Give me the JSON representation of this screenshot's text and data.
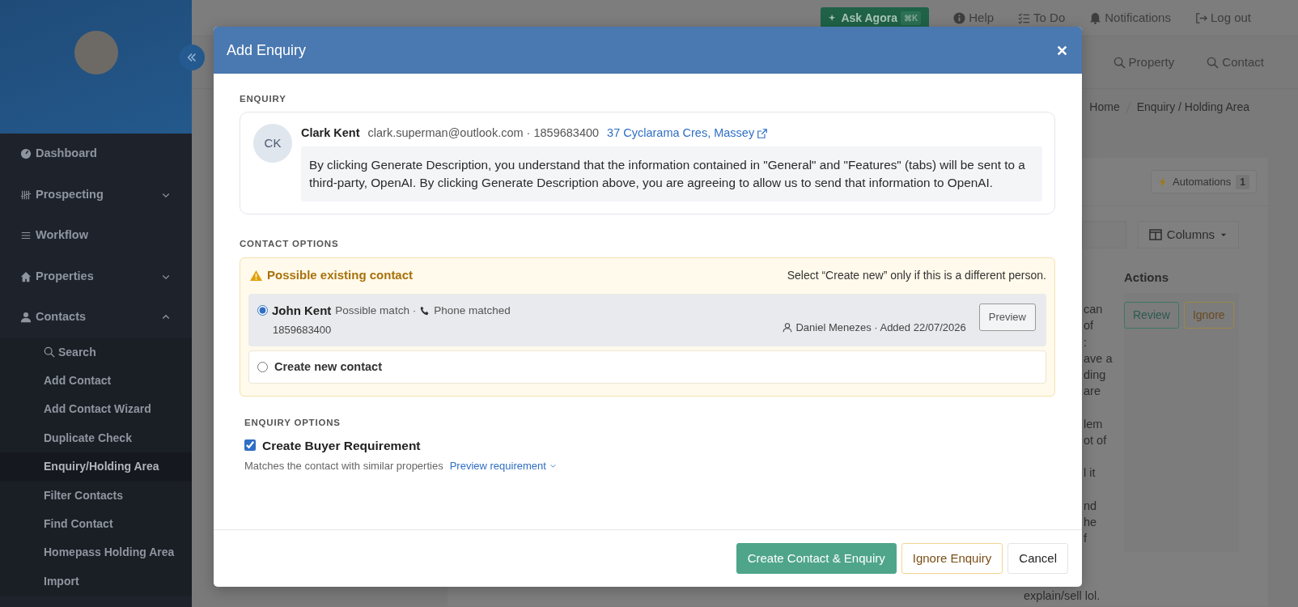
{
  "sidebar": {
    "items": [
      {
        "kind": "link",
        "label": "Dashboard"
      },
      {
        "kind": "group",
        "label": "Prospecting",
        "expanded": false
      },
      {
        "kind": "link",
        "label": "Workflow"
      },
      {
        "kind": "group",
        "label": "Properties",
        "expanded": false
      },
      {
        "kind": "group",
        "label": "Contacts",
        "expanded": true,
        "children": [
          {
            "label": "Search",
            "selected": false
          },
          {
            "label": "Add Contact",
            "selected": false
          },
          {
            "label": "Add Contact Wizard",
            "selected": false
          },
          {
            "label": "Duplicate Check",
            "selected": false
          },
          {
            "label": "Enquiry/Holding Area",
            "selected": true
          },
          {
            "label": "Filter Contacts",
            "selected": false
          },
          {
            "label": "Find Contact",
            "selected": false
          },
          {
            "label": "Homepass Holding Area",
            "selected": false
          },
          {
            "label": "Import",
            "selected": false
          }
        ]
      }
    ]
  },
  "top_bar": {
    "ask_button": {
      "label": "Ask Agora",
      "shortcut": "⌘K"
    },
    "links": [
      "Help",
      "To Do",
      "Notifications",
      "Log out"
    ]
  },
  "search_links": [
    "Property",
    "Contact"
  ],
  "breadcrumb": [
    "Home",
    "Enquiry / Holding Area"
  ],
  "automations": {
    "label": "Automations",
    "count": "1"
  },
  "columns_button": "Columns",
  "table": {
    "header": "Actions",
    "paragraphs": [
      {
        "kind": "clipped",
        "lines": [
          "can",
          "of",
          ":",
          "ave a",
          "ding",
          "are"
        ]
      },
      {
        "kind": "clipped",
        "lines": [
          "lem",
          "ot of"
        ]
      },
      {
        "kind": "clipped",
        "lines": [
          "l it"
        ]
      },
      {
        "kind": "clipped",
        "lines": [
          "nd",
          "he",
          "f"
        ]
      },
      {
        "kind": "full",
        "lines": [
          "explain/sell lol."
        ]
      }
    ],
    "row_actions": [
      {
        "kind": "review",
        "label": "Review"
      },
      {
        "kind": "ignore",
        "label": "Ignore"
      }
    ]
  },
  "modal": {
    "title": "Add Enquiry",
    "enquiry_label": "ENQUIRY",
    "enquiry": {
      "initials": "CK",
      "name": "Clark Kent",
      "contact": "clark.superman@outlook.com · 1859683400",
      "address": "37 Cyclarama Cres, Massey",
      "message": "By clicking Generate Description, you understand that the information contained in \"General\" and \"Features\" (tabs) will be sent to a third-party, OpenAI. By clicking Generate Description above, you are agreeing to allow us to send that information to OpenAI."
    },
    "contact_options": {
      "label": "CONTACT OPTIONS",
      "warning": "Possible existing contact",
      "hint": "Select “Create new” only if this is a different person.",
      "options": [
        {
          "kind": "match",
          "selected": true,
          "name": "John Kent",
          "note": "Possible match ·",
          "reason": "Phone matched",
          "phone": "1859683400",
          "owner": "Daniel Menezes · Added 22/07/2026",
          "button": "Preview"
        },
        {
          "kind": "new",
          "selected": false,
          "label": "Create new contact"
        }
      ]
    },
    "enquiry_options": {
      "label": "ENQUIRY OPTIONS",
      "checkbox": {
        "label": "Create Buyer Requirement",
        "checked": true
      },
      "help": "Matches the contact with similar properties",
      "link": "Preview requirement"
    },
    "buttons": [
      {
        "kind": "primary",
        "label": "Create Contact & Enquiry"
      },
      {
        "kind": "warning",
        "label": "Ignore Enquiry"
      },
      {
        "kind": "plain",
        "label": "Cancel"
      }
    ]
  }
}
